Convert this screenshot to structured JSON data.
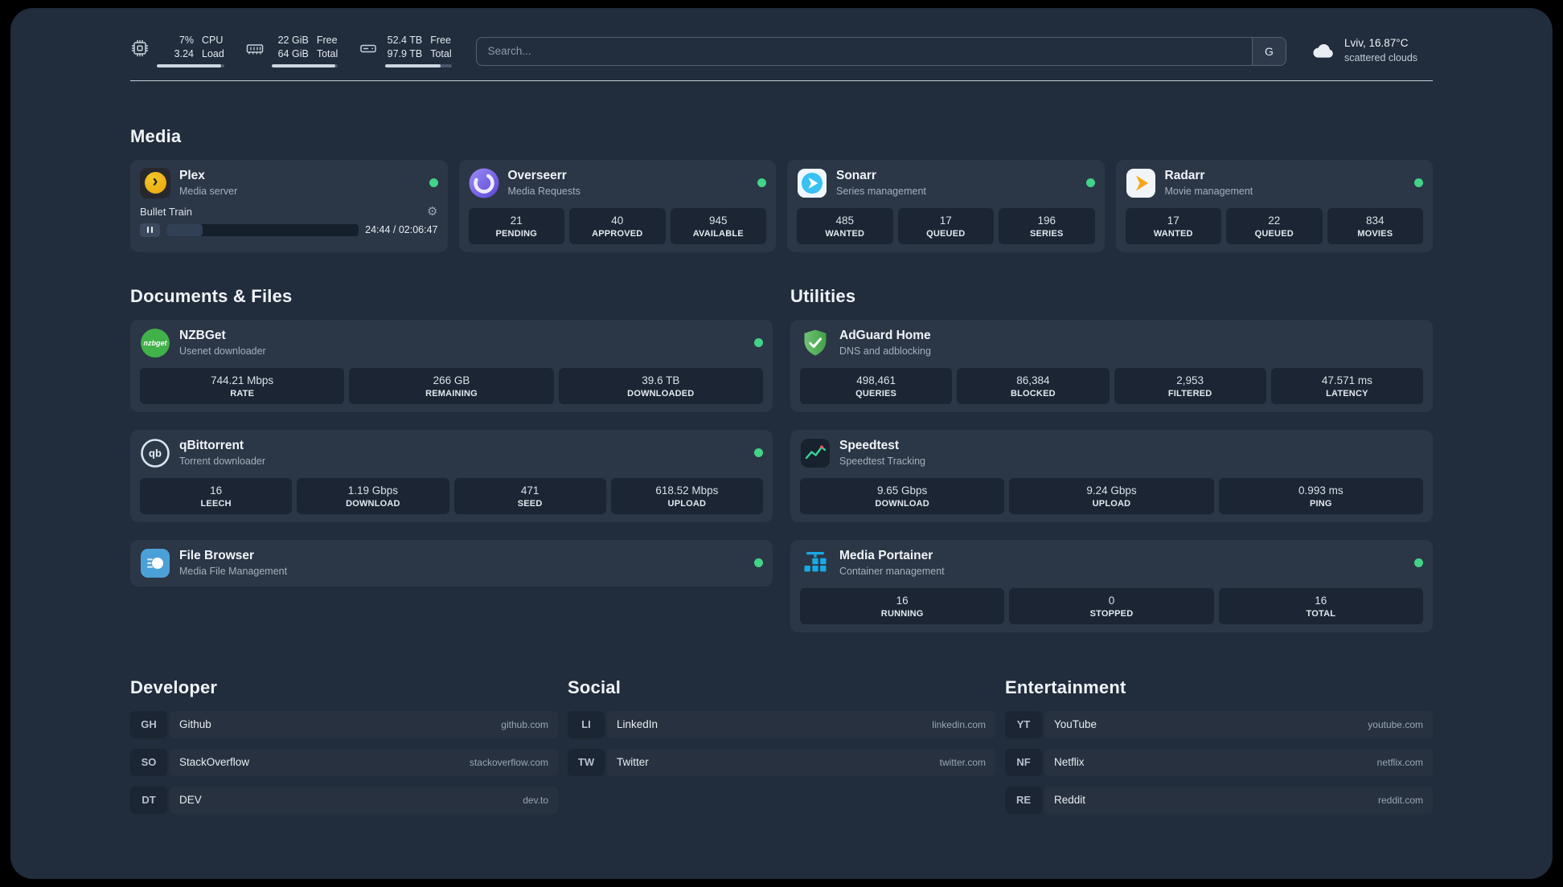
{
  "topbar": {
    "cpu": {
      "top_value": "7%",
      "top_label": "CPU",
      "bottom_value": "3.24",
      "bottom_label": "Load",
      "bar_percent": 96
    },
    "memory": {
      "top_value": "22 GiB",
      "top_label": "Free",
      "bottom_value": "64 GiB",
      "bottom_label": "Total",
      "bar_percent": 96
    },
    "disk": {
      "top_value": "52.4 TB",
      "top_label": "Free",
      "bottom_value": "97.9 TB",
      "bottom_label": "Total",
      "bar_percent": 84
    },
    "search": {
      "placeholder": "Search...",
      "provider": "G"
    },
    "weather": {
      "location": "Lviv, 16.87°C",
      "condition": "scattered clouds"
    }
  },
  "sections": {
    "media": "Media",
    "documents": "Documents & Files",
    "utilities": "Utilities",
    "developer": "Developer",
    "social": "Social",
    "entertainment": "Entertainment"
  },
  "services": {
    "plex": {
      "name": "Plex",
      "subtitle": "Media server",
      "now_playing": "Bullet Train",
      "time": "24:44 / 02:06:47",
      "progress_percent": 19
    },
    "overseerr": {
      "name": "Overseerr",
      "subtitle": "Media Requests",
      "stats": [
        {
          "value": "21",
          "label": "PENDING"
        },
        {
          "value": "40",
          "label": "APPROVED"
        },
        {
          "value": "945",
          "label": "AVAILABLE"
        }
      ]
    },
    "sonarr": {
      "name": "Sonarr",
      "subtitle": "Series management",
      "stats": [
        {
          "value": "485",
          "label": "WANTED"
        },
        {
          "value": "17",
          "label": "QUEUED"
        },
        {
          "value": "196",
          "label": "SERIES"
        }
      ]
    },
    "radarr": {
      "name": "Radarr",
      "subtitle": "Movie management",
      "stats": [
        {
          "value": "17",
          "label": "WANTED"
        },
        {
          "value": "22",
          "label": "QUEUED"
        },
        {
          "value": "834",
          "label": "MOVIES"
        }
      ]
    },
    "nzbget": {
      "name": "NZBGet",
      "subtitle": "Usenet downloader",
      "stats": [
        {
          "value": "744.21 Mbps",
          "label": "RATE"
        },
        {
          "value": "266 GB",
          "label": "REMAINING"
        },
        {
          "value": "39.6 TB",
          "label": "DOWNLOADED"
        }
      ]
    },
    "qbittorrent": {
      "name": "qBittorrent",
      "subtitle": "Torrent downloader",
      "stats": [
        {
          "value": "16",
          "label": "LEECH"
        },
        {
          "value": "1.19 Gbps",
          "label": "DOWNLOAD"
        },
        {
          "value": "471",
          "label": "SEED"
        },
        {
          "value": "618.52 Mbps",
          "label": "UPLOAD"
        }
      ]
    },
    "filebrowser": {
      "name": "File Browser",
      "subtitle": "Media File Management"
    },
    "adguard": {
      "name": "AdGuard Home",
      "subtitle": "DNS and adblocking",
      "stats": [
        {
          "value": "498,461",
          "label": "QUERIES"
        },
        {
          "value": "86,384",
          "label": "BLOCKED"
        },
        {
          "value": "2,953",
          "label": "FILTERED"
        },
        {
          "value": "47.571 ms",
          "label": "LATENCY"
        }
      ]
    },
    "speedtest": {
      "name": "Speedtest",
      "subtitle": "Speedtest Tracking",
      "stats": [
        {
          "value": "9.65 Gbps",
          "label": "DOWNLOAD"
        },
        {
          "value": "9.24 Gbps",
          "label": "UPLOAD"
        },
        {
          "value": "0.993 ms",
          "label": "PING"
        }
      ]
    },
    "portainer": {
      "name": "Media Portainer",
      "subtitle": "Container management",
      "stats": [
        {
          "value": "16",
          "label": "RUNNING"
        },
        {
          "value": "0",
          "label": "STOPPED"
        },
        {
          "value": "16",
          "label": "TOTAL"
        }
      ]
    }
  },
  "bookmarks": {
    "developer": [
      {
        "abbr": "GH",
        "name": "Github",
        "domain": "github.com"
      },
      {
        "abbr": "SO",
        "name": "StackOverflow",
        "domain": "stackoverflow.com"
      },
      {
        "abbr": "DT",
        "name": "DEV",
        "domain": "dev.to"
      }
    ],
    "social": [
      {
        "abbr": "LI",
        "name": "LinkedIn",
        "domain": "linkedin.com"
      },
      {
        "abbr": "TW",
        "name": "Twitter",
        "domain": "twitter.com"
      }
    ],
    "entertainment": [
      {
        "abbr": "YT",
        "name": "YouTube",
        "domain": "youtube.com"
      },
      {
        "abbr": "NF",
        "name": "Netflix",
        "domain": "netflix.com"
      },
      {
        "abbr": "RE",
        "name": "Reddit",
        "domain": "reddit.com"
      }
    ]
  },
  "icons": {
    "gear": "⚙",
    "plex_arrow": "›"
  },
  "colors": {
    "status_green": "#42d387",
    "plex_gold": "#e8a50c",
    "sonarr_blue": "#38c1f2",
    "radarr_orange": "#f8a51b",
    "nzbget_green": "#41b149",
    "filebrowser_blue": "#4ba0d8",
    "speedtest_green": "#35d79a",
    "portainer_blue": "#1aa9e3"
  }
}
